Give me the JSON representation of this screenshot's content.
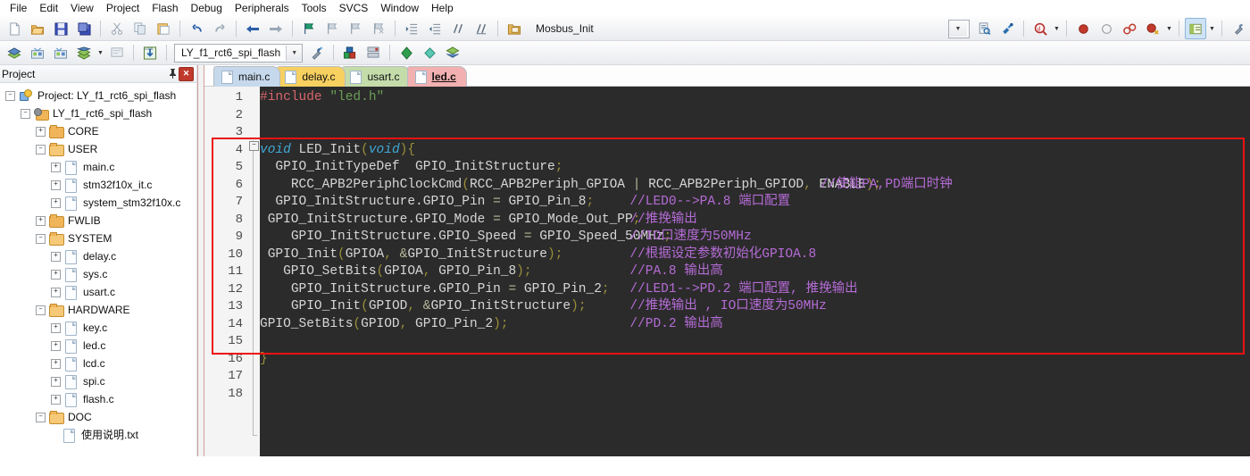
{
  "menubar": {
    "items": [
      "File",
      "Edit",
      "View",
      "Project",
      "Flash",
      "Debug",
      "Peripherals",
      "Tools",
      "SVCS",
      "Window",
      "Help"
    ]
  },
  "toolbar_top": {
    "icons": [
      "new-file-icon",
      "open-file-icon",
      "save-icon",
      "save-all-icon",
      "cut-icon",
      "copy-icon",
      "paste-icon",
      "undo-icon",
      "redo-icon",
      "navigate-back-icon",
      "navigate-forward-icon",
      "bookmark-toggle-icon",
      "bookmark-prev-icon",
      "bookmark-next-icon",
      "bookmark-clear-icon",
      "indent-right-icon",
      "indent-left-icon",
      "comment-icon",
      "uncomment-icon",
      "insert-file-icon"
    ],
    "function_label": "Mosbus_Init",
    "icons_right": [
      "browse-symbol-icon",
      "find-in-files-icon",
      "find-icon",
      "insert-breakpoint-icon",
      "disable-breakpoint-icon",
      "kill-all-breakpoints-icon",
      "disable-all-breakpoints-icon",
      "project-window-icon",
      "configuration-wizard-icon"
    ]
  },
  "toolbar_second": {
    "icons_left": [
      "translate-icon",
      "build-target-icon",
      "rebuild-all-icon",
      "batch-build-icon",
      "stop-build-icon",
      "download-icon"
    ],
    "project_combo_value": "LY_f1_rct6_spi_flash",
    "icons_right": [
      "target-options-icon",
      "manage-components-icon",
      "books-icon",
      "debug-start-icon",
      "packs-install-icon",
      "pack-manager-icon"
    ]
  },
  "project_panel": {
    "title": "Project",
    "pin_icon": "pin-icon",
    "close_icon": "close-icon",
    "tree": [
      {
        "label": "Project: LY_f1_rct6_spi_flash",
        "depth": 0,
        "icon": "project-icon",
        "expander": "-"
      },
      {
        "label": "LY_f1_rct6_spi_flash",
        "depth": 1,
        "icon": "target-icon",
        "expander": "-"
      },
      {
        "label": "CORE",
        "depth": 2,
        "icon": "folder-icon",
        "expander": "+"
      },
      {
        "label": "USER",
        "depth": 2,
        "icon": "folder-icon",
        "expander": "-"
      },
      {
        "label": "main.c",
        "depth": 3,
        "icon": "file-icon",
        "expander": "+"
      },
      {
        "label": "stm32f10x_it.c",
        "depth": 3,
        "icon": "file-icon",
        "expander": "+"
      },
      {
        "label": "system_stm32f10x.c",
        "depth": 3,
        "icon": "file-icon",
        "expander": "+"
      },
      {
        "label": "FWLIB",
        "depth": 2,
        "icon": "folder-icon",
        "expander": "+"
      },
      {
        "label": "SYSTEM",
        "depth": 2,
        "icon": "folder-icon",
        "expander": "-"
      },
      {
        "label": "delay.c",
        "depth": 3,
        "icon": "file-icon",
        "expander": "+"
      },
      {
        "label": "sys.c",
        "depth": 3,
        "icon": "file-icon",
        "expander": "+"
      },
      {
        "label": "usart.c",
        "depth": 3,
        "icon": "file-icon",
        "expander": "+"
      },
      {
        "label": "HARDWARE",
        "depth": 2,
        "icon": "folder-icon",
        "expander": "-"
      },
      {
        "label": "key.c",
        "depth": 3,
        "icon": "file-icon",
        "expander": "+"
      },
      {
        "label": "led.c",
        "depth": 3,
        "icon": "file-icon",
        "expander": "+"
      },
      {
        "label": "lcd.c",
        "depth": 3,
        "icon": "file-icon",
        "expander": "+"
      },
      {
        "label": "spi.c",
        "depth": 3,
        "icon": "file-icon",
        "expander": "+"
      },
      {
        "label": "flash.c",
        "depth": 3,
        "icon": "file-icon",
        "expander": "+"
      },
      {
        "label": "DOC",
        "depth": 2,
        "icon": "folder-icon",
        "expander": "-"
      },
      {
        "label": "使用说明.txt",
        "depth": 3,
        "icon": "file-icon",
        "expander": ""
      }
    ]
  },
  "editor": {
    "tabs": [
      {
        "label": "main.c",
        "color": "#c6d9ec",
        "active": false
      },
      {
        "label": "delay.c",
        "color": "#f7d060",
        "active": false
      },
      {
        "label": "usart.c",
        "color": "#c4dcaa",
        "active": false
      },
      {
        "label": "led.c",
        "color": "#f2b0b0",
        "active": true
      }
    ],
    "line_numbers": [
      "1",
      "2",
      "3",
      "4",
      "5",
      "6",
      "7",
      "8",
      "9",
      "10",
      "11",
      "12",
      "13",
      "14",
      "15",
      "16",
      "17",
      "18"
    ],
    "lines": [
      {
        "n": 1,
        "code": "#include \"led.h\"",
        "comment": ""
      },
      {
        "n": 2,
        "code": "",
        "comment": ""
      },
      {
        "n": 3,
        "code": "",
        "comment": ""
      },
      {
        "n": 4,
        "code": "void LED_Init(void){",
        "comment": ""
      },
      {
        "n": 5,
        "code": "  GPIO_InitTypeDef  GPIO_InitStructure;",
        "comment": ""
      },
      {
        "n": 6,
        "code": "    RCC_APB2PeriphClockCmd(RCC_APB2Periph_GPIOA | RCC_APB2Periph_GPIOD, ENABLE);",
        "comment": "//使能PA,PD端口时钟"
      },
      {
        "n": 7,
        "code": "  GPIO_InitStructure.GPIO_Pin = GPIO_Pin_8;",
        "comment": "//LED0-->PA.8 端口配置"
      },
      {
        "n": 8,
        "code": " GPIO_InitStructure.GPIO_Mode = GPIO_Mode_Out_PP;",
        "comment": "//推挽输出"
      },
      {
        "n": 9,
        "code": "    GPIO_InitStructure.GPIO_Speed = GPIO_Speed_50MHz;",
        "comment": "//IO口速度为50MHz"
      },
      {
        "n": 10,
        "code": " GPIO_Init(GPIOA, &GPIO_InitStructure);",
        "comment": "//根据设定参数初始化GPIOA.8"
      },
      {
        "n": 11,
        "code": "   GPIO_SetBits(GPIOA, GPIO_Pin_8);",
        "comment": "//PA.8 输出高"
      },
      {
        "n": 12,
        "code": "    GPIO_InitStructure.GPIO_Pin = GPIO_Pin_2;",
        "comment": "//LED1-->PD.2 端口配置, 推挽输出"
      },
      {
        "n": 13,
        "code": "    GPIO_Init(GPIOD, &GPIO_InitStructure);",
        "comment": "//推挽输出 , IO口速度为50MHz"
      },
      {
        "n": 14,
        "code": "GPIO_SetBits(GPIOD, GPIO_Pin_2);",
        "comment": "//PD.2 输出高"
      },
      {
        "n": 15,
        "code": "",
        "comment": ""
      },
      {
        "n": 16,
        "code": "}",
        "comment": ""
      },
      {
        "n": 17,
        "code": "",
        "comment": ""
      },
      {
        "n": 18,
        "code": "",
        "comment": ""
      }
    ],
    "annotation": {
      "name": "red-highlight-box",
      "color": "#ee1111"
    }
  },
  "colors": {
    "editor_bg": "#2b2b2b",
    "gutter_bg": "#f4f4f4",
    "comment": "#b56bd6",
    "keyword": "#3fa8d6",
    "string": "#6a9e55",
    "preprocessor": "#d8656a",
    "punctuation": "#9a8f3a",
    "identifier": "#d6d6d6",
    "annotation_red": "#ee1111"
  }
}
